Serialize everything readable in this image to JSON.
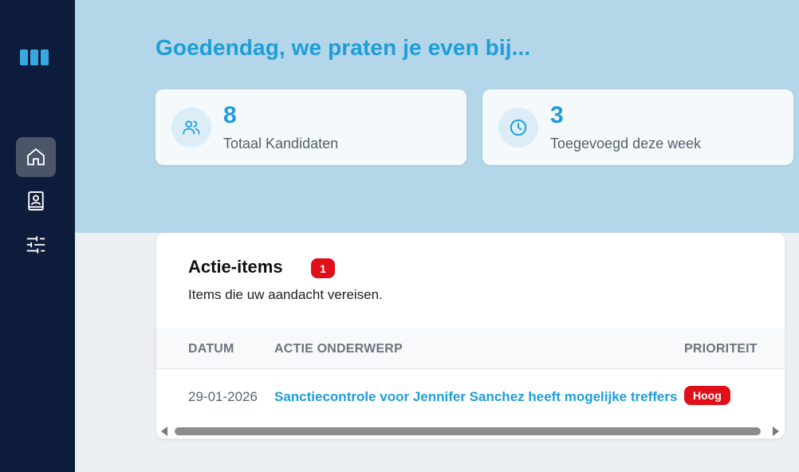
{
  "sidebar": {
    "items": [
      {
        "icon": "home-icon",
        "active": true
      },
      {
        "icon": "contact-book-icon",
        "active": false
      },
      {
        "icon": "sliders-icon",
        "active": false
      }
    ]
  },
  "header": {
    "greeting": "Goedendag, we praten je even bij..."
  },
  "stats": [
    {
      "icon": "users-icon",
      "value": "8",
      "label": "Totaal Kandidaten"
    },
    {
      "icon": "clock-icon",
      "value": "3",
      "label": "Toegevoegd deze week"
    }
  ],
  "actions": {
    "title": "Actie-items",
    "count": "1",
    "subtitle": "Items die uw aandacht vereisen.",
    "columns": [
      "DATUM",
      "ACTIE ONDERWERP",
      "PRIORITEIT"
    ],
    "rows": [
      {
        "date": "29-01-2026",
        "subject": "Sanctiecontrole voor Jennifer Sanchez heeft mogelijke treffers",
        "priority": "Hoog"
      }
    ]
  },
  "colors": {
    "accent": "#1e9ed9",
    "sidebar": "#0e1c3b",
    "hero": "#b4d6e9",
    "danger": "#e0101b"
  }
}
